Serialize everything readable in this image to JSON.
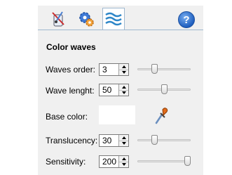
{
  "tabs": [
    {
      "icon": "shader-tools-icon",
      "active": false
    },
    {
      "icon": "gears-icon",
      "active": false
    },
    {
      "icon": "waves-icon",
      "active": true
    }
  ],
  "help_icon": "?",
  "section": {
    "title": "Color waves"
  },
  "fields": {
    "waves_order": {
      "label": "Waves order:",
      "value": "3",
      "slider_fraction": 0.3
    },
    "wave_length": {
      "label": "Wave lenght:",
      "value": "50",
      "slider_fraction": 0.5
    },
    "base_color": {
      "label": "Base color:",
      "color": "#ffffff"
    },
    "translucency": {
      "label": "Translucency:",
      "value": "30",
      "slider_fraction": 0.3
    },
    "sensitivity": {
      "label": "Sensitivity:",
      "value": "200",
      "slider_fraction": 1.0
    }
  },
  "colors": {
    "accent": "#1f5fbf",
    "panel": "#f0f0f0"
  }
}
